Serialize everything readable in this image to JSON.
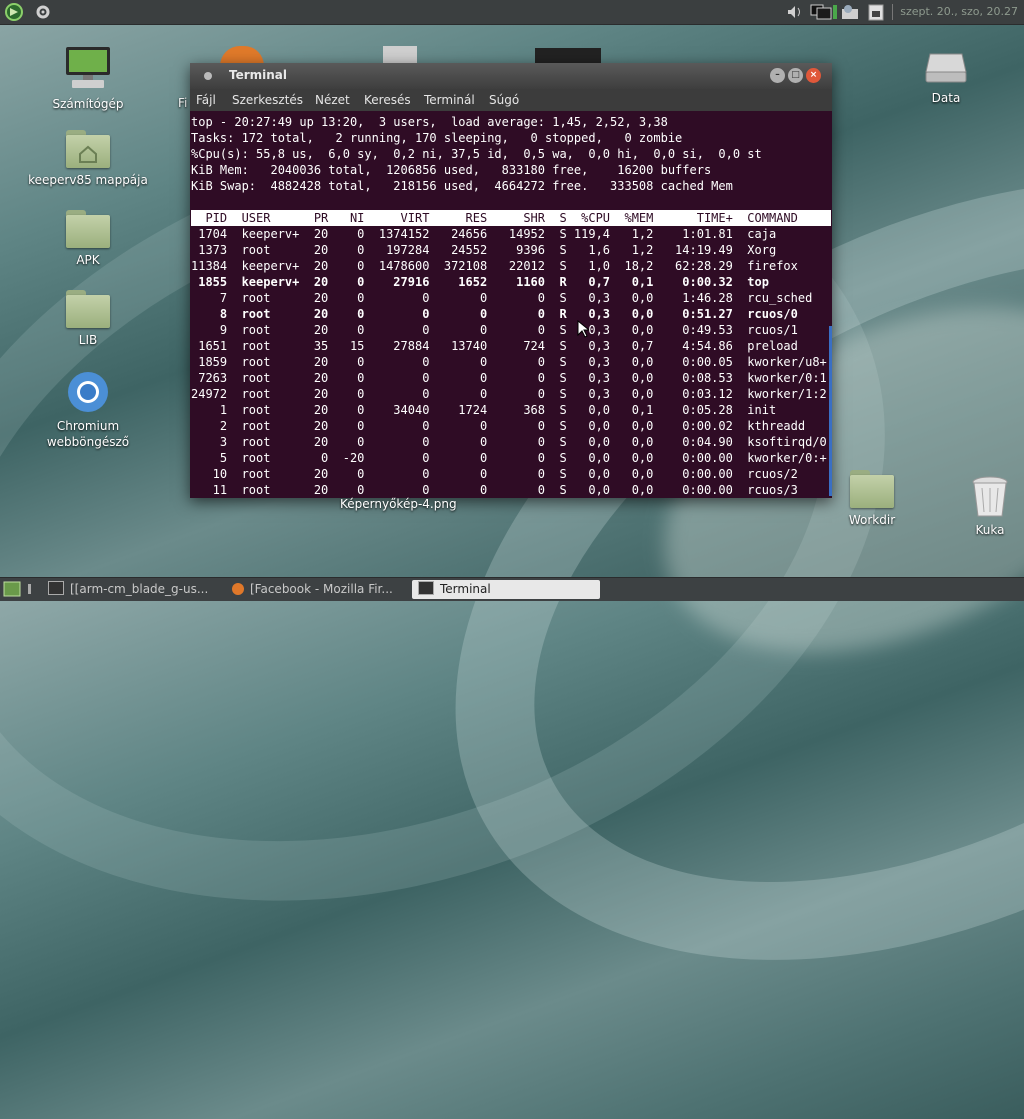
{
  "top_panel": {
    "clock": "szept. 20., szo, 20.27"
  },
  "desktop": {
    "icons": [
      {
        "label": "Számítógép"
      },
      {
        "label": "keeperv85 mappája"
      },
      {
        "label": "APK"
      },
      {
        "label": "LIB"
      },
      {
        "label": "Chromium webböngésző"
      },
      {
        "label": "Data"
      },
      {
        "label": "Workdir"
      },
      {
        "label": "Kuka"
      }
    ],
    "partial_label": "Fi",
    "caption": "Képernyőkép-4.png"
  },
  "terminal": {
    "title": "Terminal",
    "menu": [
      "Fájl",
      "Szerkesztés",
      "Nézet",
      "Keresés",
      "Terminál",
      "Súgó"
    ],
    "summary": [
      "top - 20:27:49 up 13:20,  3 users,  load average: 1,45, 2,52, 3,38",
      "Tasks: 172 total,   2 running, 170 sleeping,   0 stopped,   0 zombie",
      "%Cpu(s): 55,8 us,  6,0 sy,  0,2 ni, 37,5 id,  0,5 wa,  0,0 hi,  0,0 si,  0,0 st",
      "KiB Mem:   2040036 total,  1206856 used,   833180 free,    16200 buffers",
      "KiB Swap:  4882428 total,   218156 used,  4664272 free.   333508 cached Mem"
    ],
    "columns": [
      "PID",
      "USER",
      "PR",
      "NI",
      "VIRT",
      "RES",
      "SHR",
      "S",
      "%CPU",
      "%MEM",
      "TIME+",
      "COMMAND"
    ],
    "processes": [
      {
        "pid": "1704",
        "user": "keeperv+",
        "pr": "20",
        "ni": "0",
        "virt": "1374152",
        "res": "24656",
        "shr": "14952",
        "s": "S",
        "cpu": "119,4",
        "mem": "1,2",
        "time": "1:01.81",
        "cmd": "caja",
        "bold": false
      },
      {
        "pid": "1373",
        "user": "root",
        "pr": "20",
        "ni": "0",
        "virt": "197284",
        "res": "24552",
        "shr": "9396",
        "s": "S",
        "cpu": "1,6",
        "mem": "1,2",
        "time": "14:19.49",
        "cmd": "Xorg",
        "bold": false
      },
      {
        "pid": "11384",
        "user": "keeperv+",
        "pr": "20",
        "ni": "0",
        "virt": "1478600",
        "res": "372108",
        "shr": "22012",
        "s": "S",
        "cpu": "1,0",
        "mem": "18,2",
        "time": "62:28.29",
        "cmd": "firefox",
        "bold": false
      },
      {
        "pid": "1855",
        "user": "keeperv+",
        "pr": "20",
        "ni": "0",
        "virt": "27916",
        "res": "1652",
        "shr": "1160",
        "s": "R",
        "cpu": "0,7",
        "mem": "0,1",
        "time": "0:00.32",
        "cmd": "top",
        "bold": true
      },
      {
        "pid": "7",
        "user": "root",
        "pr": "20",
        "ni": "0",
        "virt": "0",
        "res": "0",
        "shr": "0",
        "s": "S",
        "cpu": "0,3",
        "mem": "0,0",
        "time": "1:46.28",
        "cmd": "rcu_sched",
        "bold": false
      },
      {
        "pid": "8",
        "user": "root",
        "pr": "20",
        "ni": "0",
        "virt": "0",
        "res": "0",
        "shr": "0",
        "s": "R",
        "cpu": "0,3",
        "mem": "0,0",
        "time": "0:51.27",
        "cmd": "rcuos/0",
        "bold": true
      },
      {
        "pid": "9",
        "user": "root",
        "pr": "20",
        "ni": "0",
        "virt": "0",
        "res": "0",
        "shr": "0",
        "s": "S",
        "cpu": "0,3",
        "mem": "0,0",
        "time": "0:49.53",
        "cmd": "rcuos/1",
        "bold": false
      },
      {
        "pid": "1651",
        "user": "root",
        "pr": "35",
        "ni": "15",
        "virt": "27884",
        "res": "13740",
        "shr": "724",
        "s": "S",
        "cpu": "0,3",
        "mem": "0,7",
        "time": "4:54.86",
        "cmd": "preload",
        "bold": false
      },
      {
        "pid": "1859",
        "user": "root",
        "pr": "20",
        "ni": "0",
        "virt": "0",
        "res": "0",
        "shr": "0",
        "s": "S",
        "cpu": "0,3",
        "mem": "0,0",
        "time": "0:00.05",
        "cmd": "kworker/u8+",
        "bold": false
      },
      {
        "pid": "7263",
        "user": "root",
        "pr": "20",
        "ni": "0",
        "virt": "0",
        "res": "0",
        "shr": "0",
        "s": "S",
        "cpu": "0,3",
        "mem": "0,0",
        "time": "0:08.53",
        "cmd": "kworker/0:1",
        "bold": false
      },
      {
        "pid": "24972",
        "user": "root",
        "pr": "20",
        "ni": "0",
        "virt": "0",
        "res": "0",
        "shr": "0",
        "s": "S",
        "cpu": "0,3",
        "mem": "0,0",
        "time": "0:03.12",
        "cmd": "kworker/1:2",
        "bold": false
      },
      {
        "pid": "1",
        "user": "root",
        "pr": "20",
        "ni": "0",
        "virt": "34040",
        "res": "1724",
        "shr": "368",
        "s": "S",
        "cpu": "0,0",
        "mem": "0,1",
        "time": "0:05.28",
        "cmd": "init",
        "bold": false
      },
      {
        "pid": "2",
        "user": "root",
        "pr": "20",
        "ni": "0",
        "virt": "0",
        "res": "0",
        "shr": "0",
        "s": "S",
        "cpu": "0,0",
        "mem": "0,0",
        "time": "0:00.02",
        "cmd": "kthreadd",
        "bold": false
      },
      {
        "pid": "3",
        "user": "root",
        "pr": "20",
        "ni": "0",
        "virt": "0",
        "res": "0",
        "shr": "0",
        "s": "S",
        "cpu": "0,0",
        "mem": "0,0",
        "time": "0:04.90",
        "cmd": "ksoftirqd/0",
        "bold": false
      },
      {
        "pid": "5",
        "user": "root",
        "pr": "0",
        "ni": "-20",
        "virt": "0",
        "res": "0",
        "shr": "0",
        "s": "S",
        "cpu": "0,0",
        "mem": "0,0",
        "time": "0:00.00",
        "cmd": "kworker/0:+",
        "bold": false
      },
      {
        "pid": "10",
        "user": "root",
        "pr": "20",
        "ni": "0",
        "virt": "0",
        "res": "0",
        "shr": "0",
        "s": "S",
        "cpu": "0,0",
        "mem": "0,0",
        "time": "0:00.00",
        "cmd": "rcuos/2",
        "bold": false
      },
      {
        "pid": "11",
        "user": "root",
        "pr": "20",
        "ni": "0",
        "virt": "0",
        "res": "0",
        "shr": "0",
        "s": "S",
        "cpu": "0,0",
        "mem": "0,0",
        "time": "0:00.00",
        "cmd": "rcuos/3",
        "bold": false
      }
    ]
  },
  "taskbar": {
    "tasks": [
      {
        "label": "[[arm-cm_blade_g-us...",
        "icon": "terminal-icon",
        "active": false
      },
      {
        "label": "[Facebook - Mozilla Fir...",
        "icon": "firefox-icon",
        "active": false
      },
      {
        "label": "Terminal",
        "icon": "terminal-icon",
        "active": true
      }
    ]
  }
}
